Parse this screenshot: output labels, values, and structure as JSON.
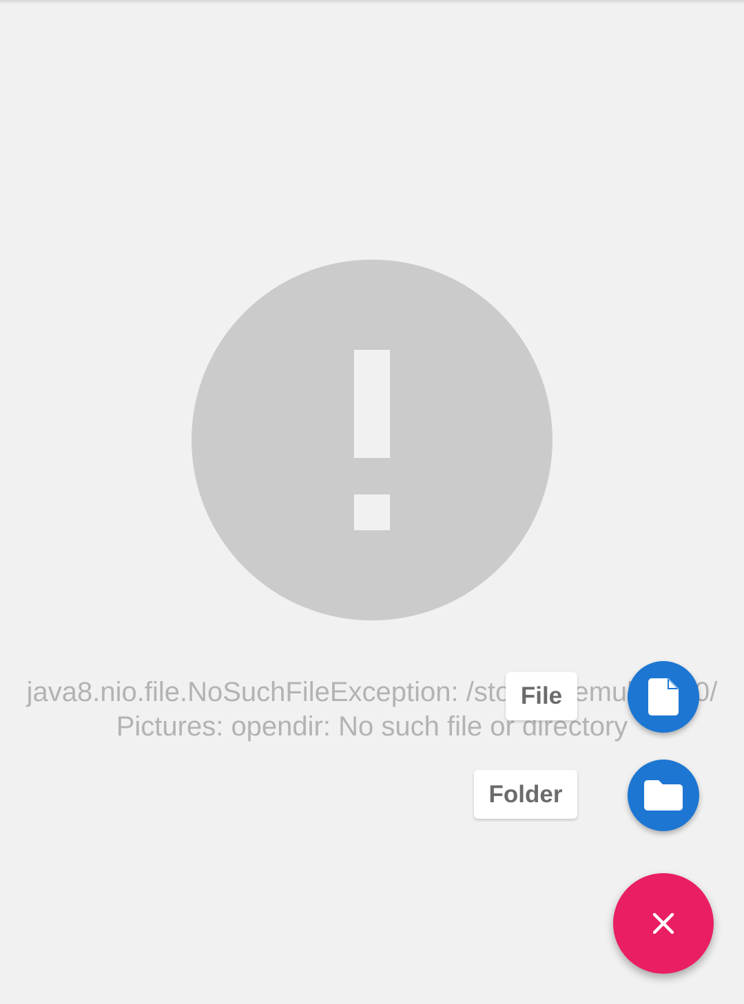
{
  "error": {
    "icon": "error-exclamation-icon",
    "message_lines": [
      "java8.nio.file.NoSuchFileException: /storage/emulated/0/",
      "Pictures: opendir: No such file or directory"
    ]
  },
  "speed_dial": {
    "items": [
      {
        "label": "File",
        "icon": "file-icon"
      },
      {
        "label": "Folder",
        "icon": "folder-icon"
      }
    ],
    "close_icon": "close-icon"
  },
  "colors": {
    "background": "#f1f1f1",
    "error_icon": "#cbcbcb",
    "message_text": "#b3b3b3",
    "mini_fab": "#1c76d2",
    "main_fab": "#e91e63"
  }
}
